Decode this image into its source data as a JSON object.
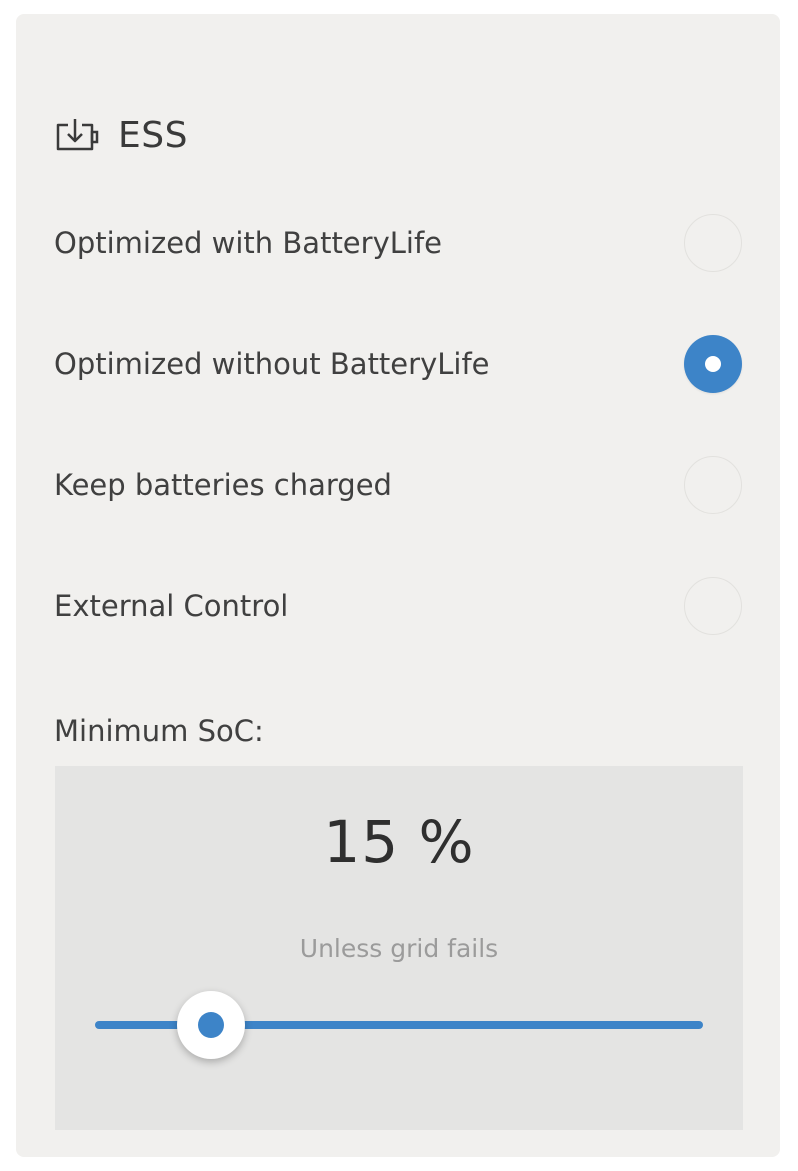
{
  "header": {
    "icon": "battery-download-icon",
    "title": "ESS"
  },
  "options": [
    {
      "label": "Optimized with BatteryLife",
      "selected": false
    },
    {
      "label": "Optimized without BatteryLife",
      "selected": true
    },
    {
      "label": "Keep batteries charged",
      "selected": false
    },
    {
      "label": "External Control",
      "selected": false
    }
  ],
  "min_soc": {
    "label": "Minimum SoC:",
    "value_text": "15 %",
    "subtitle": "Unless grid fails",
    "slider_fraction": 0.19
  },
  "colors": {
    "accent": "#3d84c8",
    "card_background": "#f1f0ee",
    "panel_background": "#e4e4e3"
  }
}
